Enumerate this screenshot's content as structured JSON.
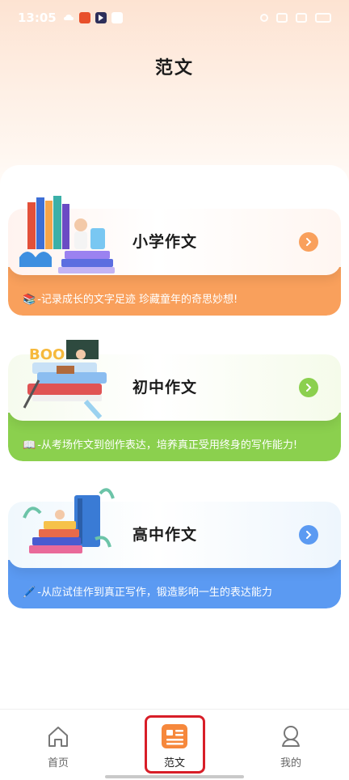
{
  "status_bar": {
    "time": "13:05"
  },
  "page": {
    "title": "范文"
  },
  "cards": [
    {
      "title": "小学作文",
      "emoji": "📚",
      "desc": "-记录成长的文字足迹 珍藏童年的奇思妙想!",
      "accent": "#f9a05c"
    },
    {
      "title": "初中作文",
      "emoji": "📖",
      "desc": "-从考场作文到创作表达，培养真正受用终身的写作能力!",
      "accent": "#8bd04e"
    },
    {
      "title": "高中作文",
      "emoji": "🖊️",
      "desc": "-从应试佳作到真正写作，锻造影响一生的表达能力",
      "accent": "#5b9af2"
    }
  ],
  "nav": {
    "items": [
      {
        "label": "首页",
        "icon": "home-icon"
      },
      {
        "label": "范文",
        "icon": "essay-icon"
      },
      {
        "label": "我的",
        "icon": "profile-icon"
      }
    ],
    "active": "范文"
  }
}
